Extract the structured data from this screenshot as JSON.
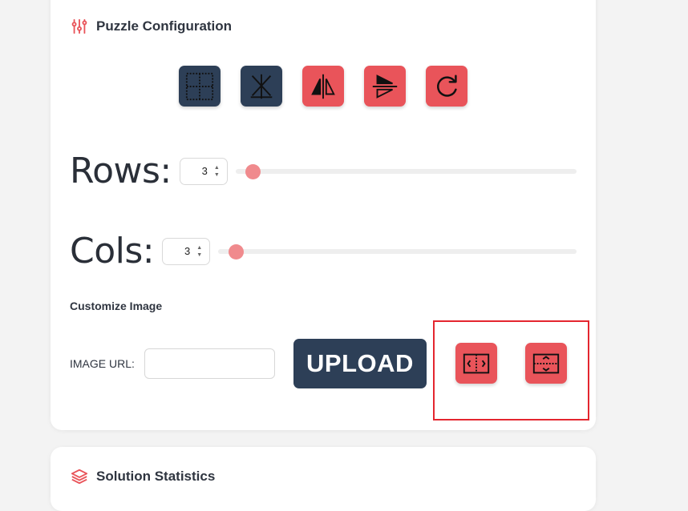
{
  "config": {
    "title": "Puzzle Configuration",
    "header_icon": "sliders-icon",
    "toolbar": [
      {
        "name": "grid-lines-icon",
        "style": "dark"
      },
      {
        "name": "no-grid-icon",
        "style": "dark"
      },
      {
        "name": "flip-horizontal-icon",
        "style": "red"
      },
      {
        "name": "flip-vertical-icon",
        "style": "red"
      },
      {
        "name": "rotate-icon",
        "style": "red"
      }
    ],
    "rows": {
      "label": "Rows:",
      "value": "3",
      "level": 0.03
    },
    "cols": {
      "label": "Cols:",
      "value": "3",
      "level": 0.03
    },
    "customize_title": "Customize Image",
    "image_url": {
      "label": "IMAGE URL:",
      "value": "",
      "placeholder": ""
    },
    "upload_label": "UPLOAD",
    "fit_buttons": [
      "fit-width-icon",
      "fit-height-icon"
    ],
    "accent_red": "#e9545a",
    "accent_dark": "#2d3f57",
    "highlight_color": "#e4262f"
  },
  "stats": {
    "title": "Solution Statistics",
    "header_icon": "layers-icon"
  }
}
